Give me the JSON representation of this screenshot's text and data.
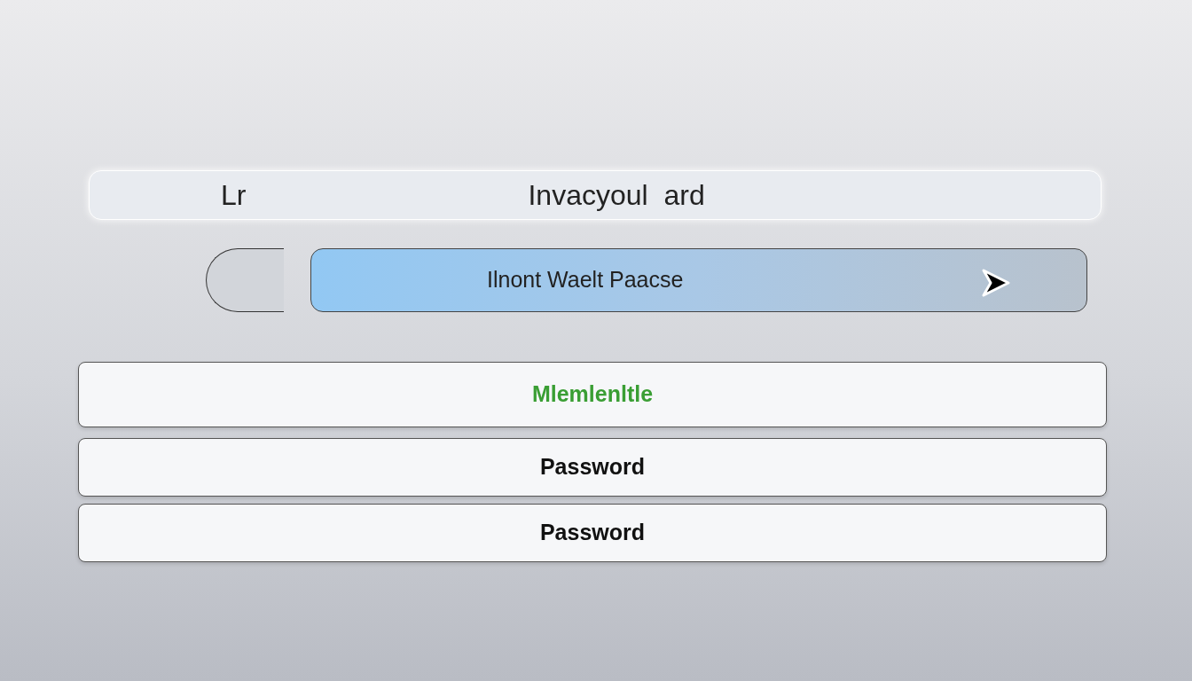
{
  "top_bar": {
    "left_text": "Lr",
    "title": "Invacyoul  ard"
  },
  "action_row": {
    "primary_button": {
      "label": "Ilnont Waelt Paacse"
    }
  },
  "fields": [
    {
      "value": "Mlemlenltle",
      "color": "#3a9e34"
    },
    {
      "value": "Password",
      "color": "#111111"
    },
    {
      "value": "Password",
      "color": "#111111"
    }
  ]
}
